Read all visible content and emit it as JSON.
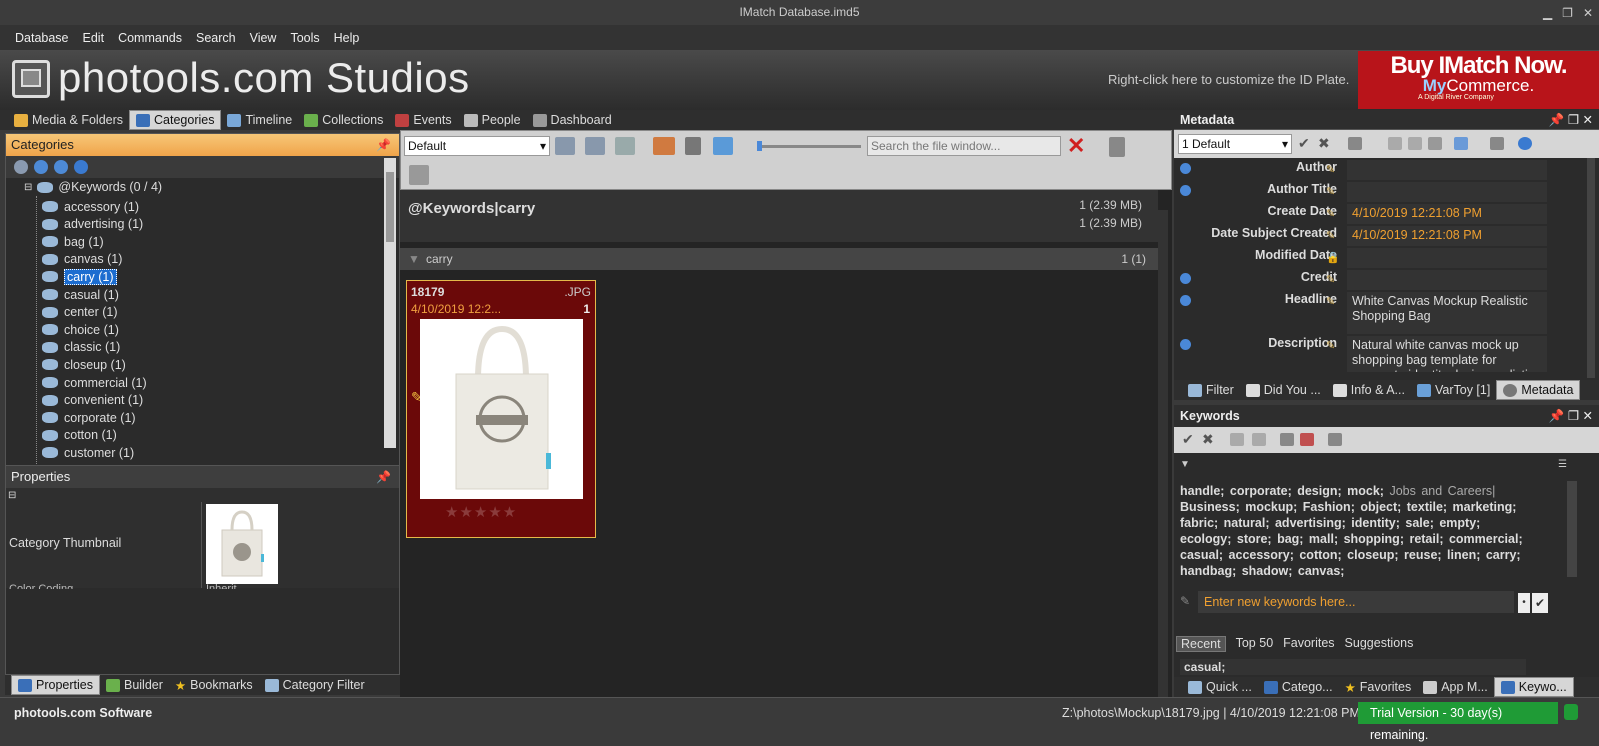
{
  "window": {
    "title": "IMatch Database.imd5",
    "controls": [
      "▁",
      "❐",
      "✕"
    ]
  },
  "menu": [
    "Database",
    "Edit",
    "Commands",
    "Search",
    "View",
    "Tools",
    "Help"
  ],
  "id_plate": {
    "brand": "photools.com Studios",
    "hint": "Right-click here to customize the ID Plate."
  },
  "ad": {
    "line1": "Buy IMatch Now.",
    "line2_bold": "My",
    "line2": "Commerce.",
    "line3": "A Digital River Company"
  },
  "view_tabs": [
    "Media & Folders",
    "Categories",
    "Timeline",
    "Collections",
    "Events",
    "People",
    "Dashboard"
  ],
  "categories": {
    "title": "Categories",
    "root": "@Keywords (0 / 4)",
    "items": [
      "accessory (1)",
      "advertising (1)",
      "bag (1)",
      "canvas (1)",
      "carry (1)",
      "casual (1)",
      "center (1)",
      "choice (1)",
      "classic (1)",
      "closeup (1)",
      "commercial (1)",
      "convenient (1)",
      "corporate (1)",
      "cotton (1)",
      "customer (1)"
    ],
    "selected_index": 4
  },
  "properties": {
    "title": "Properties",
    "label": "Category Thumbnail",
    "cut_label": "Color Coding",
    "cut_value": "Inherit"
  },
  "left_tabs": [
    "Properties",
    "Builder",
    "Bookmarks",
    "Category Filter"
  ],
  "file_window": {
    "sort": "Default",
    "search_placeholder": "Search the file window...",
    "path_title": "@Keywords|carry",
    "stat1": "1 (2.39 MB)",
    "stat2": "1 (2.39 MB)",
    "group_name": "carry",
    "group_count": "1 (1)",
    "file": {
      "name": "18179",
      "ext": ".JPG",
      "date": "4/10/2019 12:2...",
      "num": "1",
      "rating": 0
    }
  },
  "metadata": {
    "title": "Metadata",
    "preset": "1 Default",
    "rows": [
      {
        "label": "Author",
        "value": "",
        "info": true
      },
      {
        "label": "Author Title",
        "value": "",
        "info": true
      },
      {
        "label": "Create Date",
        "value": "4/10/2019 12:21:08 PM",
        "info": false
      },
      {
        "label": "Date Subject Created",
        "value": "4/10/2019 12:21:08 PM",
        "info": false
      },
      {
        "label": "Modified Date",
        "value": "",
        "info": false
      },
      {
        "label": "Credit",
        "value": "",
        "info": true
      },
      {
        "label": "Headline",
        "value": "White Canvas Mockup Realistic Shopping Bag",
        "info": true
      },
      {
        "label": "Description",
        "value": "Natural white canvas mock up shopping bag template for corporate identity design realistic closeup",
        "info": true
      }
    ]
  },
  "meta_tabs": [
    "Filter",
    "Did You ...",
    "Info & A...",
    "VarToy [1]",
    "Metadata"
  ],
  "keywords": {
    "title": "Keywords",
    "list_bold": "handle;  corporate;  design;  mock;",
    "list_light": "Jobs and Careers|",
    "list_rest": "Business;  mockup;  Fashion;  object;  textile;  marketing;  fabric;  natural;  advertising;  identity;  sale;  empty;  ecology;  store;  bag;  mall;  shopping;  retail;  commercial;  casual;  accessory;  cotton;  closeup;  reuse;  linen;  carry;  handbag;  shadow;  canvas;",
    "input_placeholder": "Enter new keywords here...",
    "subtabs": [
      "Recent",
      "Top 50",
      "Favorites",
      "Suggestions"
    ],
    "recent": "casual;"
  },
  "bottom_tabs": [
    "Quick ...",
    "Catego...",
    "Favorites",
    "App M...",
    "Keywo..."
  ],
  "status": {
    "left": "photools.com Software",
    "path": "Z:\\photos\\Mockup\\18179.jpg | 4/10/2019 12:21:08 PM",
    "trial": "Trial Version - 30 day(s) remaining."
  },
  "colors": {
    "accent_orange": "#f0a44a",
    "selection_blue": "#1c6dd0",
    "cell_bg": "#6b0909",
    "trial_green": "#1f9b36",
    "ad_red": "#b8141a"
  }
}
